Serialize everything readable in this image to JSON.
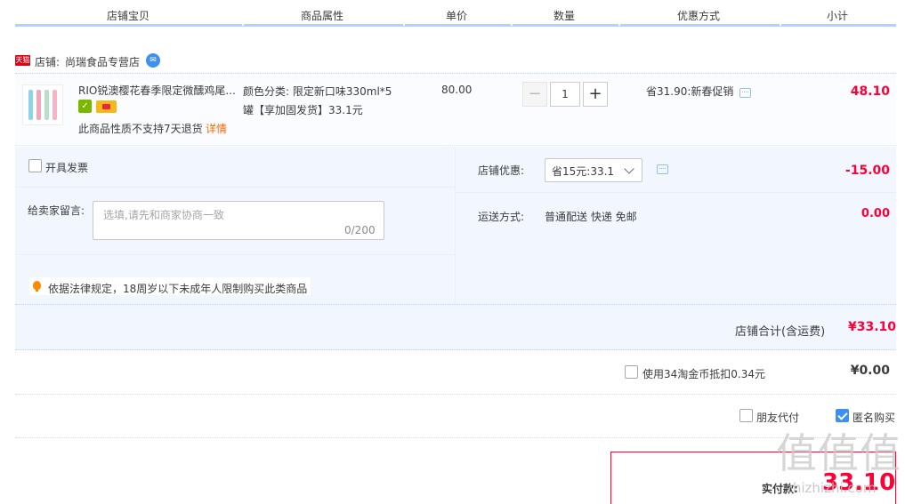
{
  "header": {
    "columns": [
      "店铺宝贝",
      "商品属性",
      "单价",
      "数量",
      "优惠方式",
      "小计"
    ]
  },
  "shop": {
    "tmall_badge": "天猫",
    "label": "店铺:",
    "name": "尚瑞食品专营店"
  },
  "item": {
    "title": "RIO锐澳樱花春季限定微醺鸡尾...",
    "attr_line1": "颜色分类: 限定新口味330ml*5",
    "attr_line2": "罐【享加固发货】33.1元",
    "no_return": "此商品性质不支持7天退货",
    "detail_link": "详情",
    "unit_price": "80.00",
    "quantity": "1",
    "qty_minus": "−",
    "qty_plus": "+",
    "promo": "省31.90:新春促销",
    "subtotal": "48.10"
  },
  "extras": {
    "invoice_label": "开具发票",
    "message_label": "给卖家留言:",
    "message_placeholder": "选填,请先和商家协商一致",
    "message_count": "0/200",
    "law_notice": "依据法律规定，18周岁以下未成年人限制购买此类商品",
    "shop_discount_label": "店铺优惠:",
    "shop_discount_value": "省15元:33.1",
    "shop_discount_amount": "-15.00",
    "shipping_label": "运送方式:",
    "shipping_value": "普通配送 快递 免邮",
    "shipping_amount": "0.00"
  },
  "shop_total": {
    "label": "店铺合计(含运费)",
    "amount": "¥33.10"
  },
  "coins": {
    "label": "使用34淘金币抵扣0.34元",
    "amount": "¥0.00"
  },
  "options": {
    "friend_pay": "朋友代付",
    "anonymous": "匿名购买",
    "anonymous_checked": true
  },
  "pay": {
    "label": "实付款:",
    "amount": "33.10"
  },
  "watermark": {
    "glyphs": "值值值",
    "url": "zhizhizhi.com"
  },
  "colors": {
    "accent_blue": "#b2d1ff",
    "price_red": "#ff0036",
    "panel_bg": "#f2f7ff"
  }
}
